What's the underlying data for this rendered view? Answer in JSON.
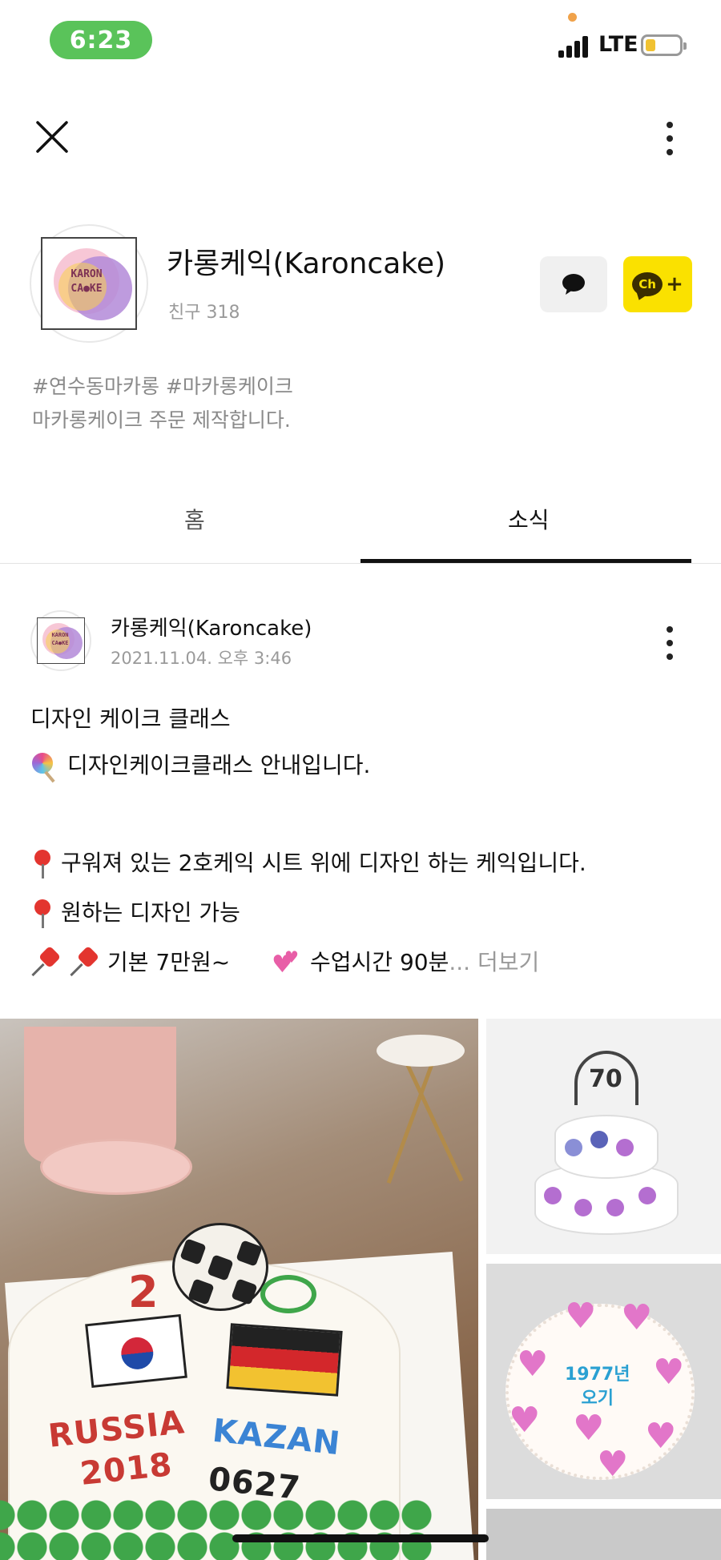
{
  "status_bar": {
    "time": "6:23",
    "network": "LTE"
  },
  "profile": {
    "name": "카롱케익(Karoncake)",
    "friends": "친구 318",
    "avatar_text": "KARON CA●KE",
    "tags_line1": "#연수동마카롱 #마카롱케이크",
    "tags_line2": "마카롱케이크 주문 제작합니다."
  },
  "tabs": [
    {
      "label": "홈"
    },
    {
      "label": "소식"
    }
  ],
  "post": {
    "author": "카롱케익(Karoncake)",
    "date": "2021.11.04. 오후 3:46",
    "title": "디자인 케이크 클래스",
    "line1": "디자인케이크클래스 안내입니다.",
    "line2": "구워져 있는 2호케익 시트 위에  디자인 하는 케익입니다.",
    "line3": "원하는 디자인 가능",
    "line4a": "기본 7만원~",
    "line4b": "수업시간 90분",
    "ellipsis": "...",
    "more": "더보기"
  },
  "photos": {
    "main_texts": [
      "RUSSIA",
      "2018",
      "KAZAN",
      "0627",
      "2"
    ],
    "top_right_topper": "70",
    "mid_right_writing": [
      "1977년",
      "오기"
    ]
  },
  "colors": {
    "time_pill": "#5ac35a",
    "channel_yellow": "#fae100",
    "battery": "#f1c232"
  },
  "icons": [
    "close-icon",
    "more-vertical-icon",
    "chat-bubble-icon",
    "channel-add-icon",
    "lollipop-icon",
    "round-pin-icon",
    "pushpin-icon",
    "hearts-icon"
  ]
}
